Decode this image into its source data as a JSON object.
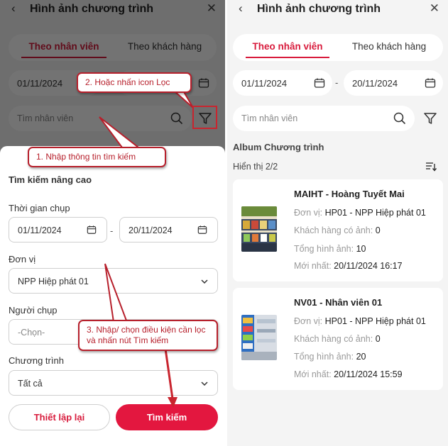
{
  "header": {
    "title": "Hình ảnh chương trình",
    "back_icon": "‹",
    "close_icon": "✕"
  },
  "tabs": [
    {
      "label": "Theo nhân viên",
      "active": true
    },
    {
      "label": "Theo khách hàng",
      "active": false
    }
  ],
  "date_range": {
    "from": "01/11/2024",
    "to": "20/11/2024",
    "separator": "-"
  },
  "search": {
    "placeholder": "Tìm nhân viên"
  },
  "album": {
    "section_title": "Album Chương trình",
    "count_label": "Hiển thị 2/2",
    "cards": [
      {
        "title": "MAIHT - Hoàng Tuyết Mai",
        "unit_label": "Đơn vị:",
        "unit_value": "HP01 - NPP Hiệp phát 01",
        "customers_label": "Khách hàng có ảnh:",
        "customers_value": "0",
        "total_label": "Tổng hình ảnh:",
        "total_value": "10",
        "latest_label": "Mới nhất:",
        "latest_value": "20/11/2024 16:17"
      },
      {
        "title": "NV01 - Nhân viên 01",
        "unit_label": "Đơn vị:",
        "unit_value": "HP01 - NPP Hiệp phát 01",
        "customers_label": "Khách hàng có ảnh:",
        "customers_value": "0",
        "total_label": "Tổng hình ảnh:",
        "total_value": "20",
        "latest_label": "Mới nhất:",
        "latest_value": "20/11/2024 15:59"
      }
    ]
  },
  "advanced_search": {
    "title": "Tìm kiếm nâng cao",
    "time_label": "Thời gian chụp",
    "from": "01/11/2024",
    "to": "20/11/2024",
    "unit_label": "Đơn vị",
    "unit_value": "NPP Hiệp phát 01",
    "photographer_label": "Người chụp",
    "photographer_placeholder": "-Chọn-",
    "program_label": "Chương trình",
    "program_value": "Tất cả",
    "reset_button": "Thiết lập lại",
    "search_button": "Tìm kiếm"
  },
  "annotations": {
    "step1": "1. Nhập thông tin tìm kiếm",
    "step2": "2. Hoặc nhấn icon Lọc",
    "step3": "3. Nhập/ chọn điều kiện cần lọc và nhấn nút Tìm kiếm"
  },
  "colors": {
    "accent": "#d81b3c",
    "button": "#e3173f",
    "annotation": "#b7202c"
  }
}
